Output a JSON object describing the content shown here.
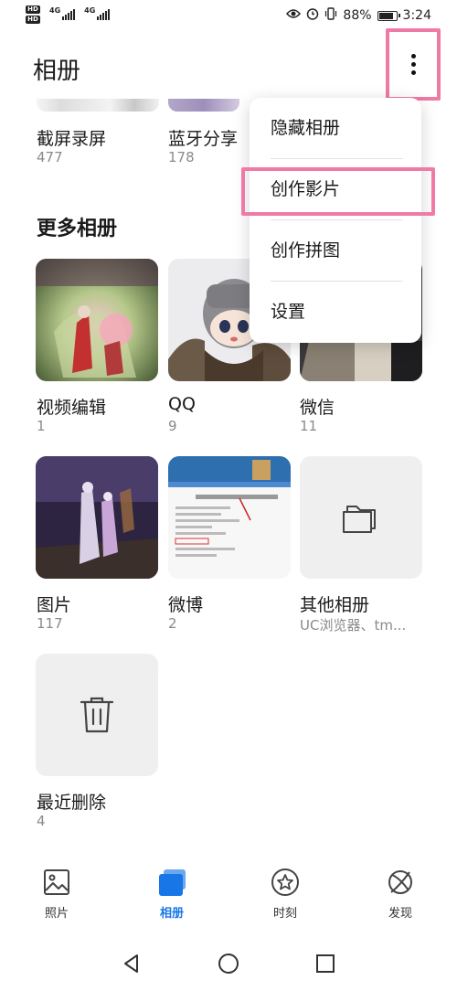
{
  "status_bar": {
    "left_sim1_tag": "HD",
    "left_sim2_tag": "HD",
    "network1": "4G",
    "network2": "4G",
    "battery_percent": "88%",
    "battery_level": 0.88,
    "time": "3:24",
    "icons": [
      "eye-icon",
      "alarm-icon",
      "vibrate-icon",
      "battery-icon"
    ]
  },
  "header": {
    "title": "相册",
    "more_icon": "more-vertical-icon"
  },
  "top_albums": [
    {
      "name": "截屏录屏",
      "count": "477"
    },
    {
      "name": "蓝牙分享",
      "count": "178"
    }
  ],
  "section_title": "更多相册",
  "albums": [
    {
      "name": "视频编辑",
      "count": "1"
    },
    {
      "name": "QQ",
      "count": "9"
    },
    {
      "name": "微信",
      "count": "11"
    },
    {
      "name": "图片",
      "count": "117"
    },
    {
      "name": "微博",
      "count": "2"
    },
    {
      "name": "其他相册",
      "count": "UC浏览器、tm..."
    },
    {
      "name": "最近删除",
      "count": "4"
    }
  ],
  "thumb_icons": {
    "other": "folder-icon",
    "deleted": "trash-icon"
  },
  "menu": {
    "items": [
      "隐藏相册",
      "创作影片",
      "创作拼图",
      "设置"
    ]
  },
  "bottom_nav": {
    "items": [
      {
        "label": "照片",
        "icon": "photo-icon"
      },
      {
        "label": "相册",
        "icon": "album-icon"
      },
      {
        "label": "时刻",
        "icon": "star-icon"
      },
      {
        "label": "发现",
        "icon": "discover-icon"
      }
    ],
    "active_index": 1,
    "active_color": "#1976e6"
  },
  "system_nav": [
    "back-icon",
    "home-icon",
    "recents-icon"
  ],
  "colors": {
    "highlight": "#f07aa6",
    "accent": "#1976e6"
  }
}
